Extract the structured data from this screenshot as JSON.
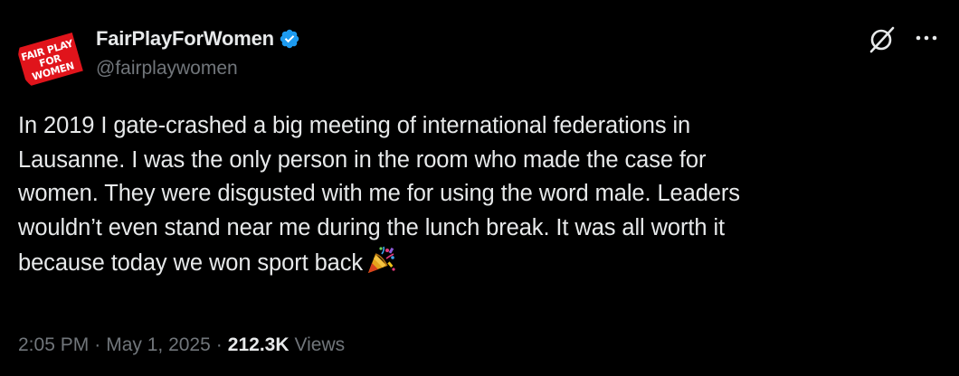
{
  "author": {
    "display_name": "FairPlayForWomen",
    "handle": "@fairplaywomen",
    "avatar_text_line1": "FAIR PLAY",
    "avatar_text_line2": "FOR WOMEN",
    "verified_icon": "verified-badge-icon"
  },
  "header_actions": {
    "grok_icon": "grok-icon",
    "more_icon": "more-icon"
  },
  "tweet": {
    "lines": [
      "In 2019 I gate-crashed a big meeting of international federations in",
      "Lausanne. I was the only person in the room who made the case for",
      "women. They were disgusted with me for using the word male. Leaders",
      "wouldn’t even stand near me during the lunch break. It was all worth it",
      "because today we won sport back"
    ],
    "emoji": "party-popper-icon"
  },
  "meta": {
    "time": "2:05 PM",
    "separator": "·",
    "date": "May 1, 2025",
    "views_count": "212.3K",
    "views_label": "Views"
  },
  "colors": {
    "background": "#000000",
    "primary_text": "#e7e9ea",
    "secondary_text": "#71767b",
    "verified_blue": "#1d9bf0",
    "logo_red": "#e0141b"
  }
}
